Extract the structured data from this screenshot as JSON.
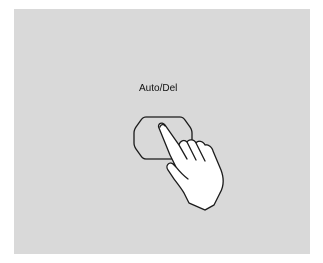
{
  "panel": {
    "button_label": "Auto/Del",
    "button_icon": "rounded-octagon-button",
    "hand_icon": "pointing-hand-icon"
  },
  "colors": {
    "panel_background": "#d9d9d9",
    "line": "#1a1a1a",
    "fill": "#ffffff"
  }
}
